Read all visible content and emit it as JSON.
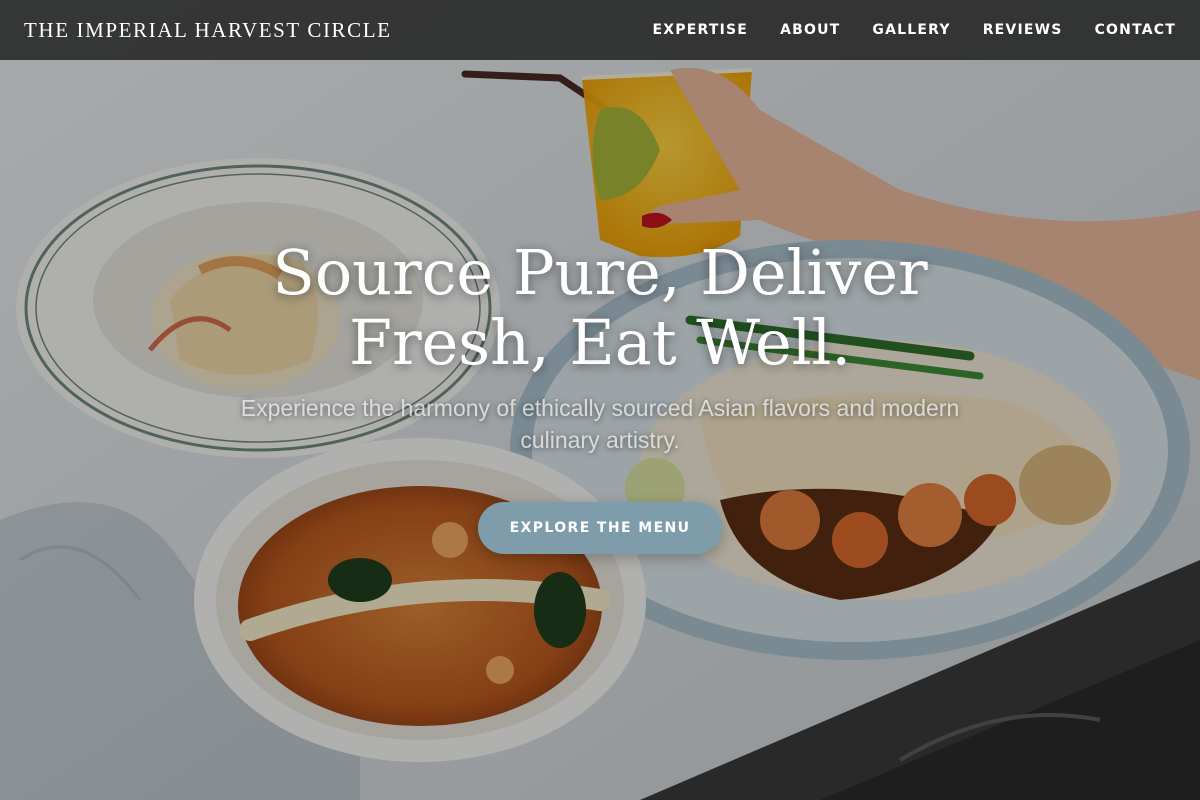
{
  "header": {
    "brand": "THE IMPERIAL HARVEST CIRCLE",
    "nav": [
      {
        "label": "EXPERTISE"
      },
      {
        "label": "ABOUT"
      },
      {
        "label": "GALLERY"
      },
      {
        "label": "REVIEWS"
      },
      {
        "label": "CONTACT"
      }
    ]
  },
  "hero": {
    "title_line1": "Source Pure, Deliver",
    "title_line2": "Fresh, Eat Well.",
    "subtitle": "Experience the harmony of ethically sourced Asian flavors and modern culinary artistry.",
    "cta_label": "EXPLORE THE MENU",
    "background_image": "food-table-photo"
  },
  "colors": {
    "header_bg": "#1c1c1c",
    "cta_bg": "#7f9cab",
    "text": "#ffffff"
  }
}
